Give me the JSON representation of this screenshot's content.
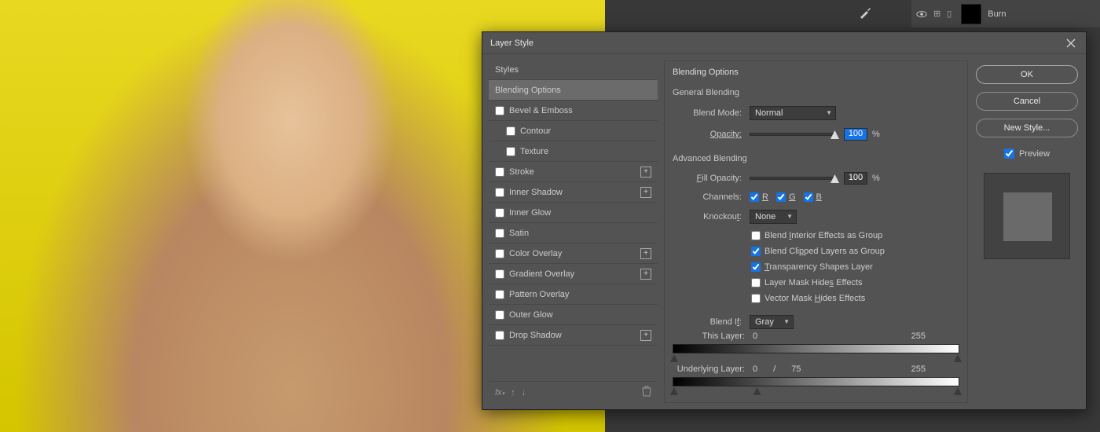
{
  "canvas": {},
  "layers_panel": {
    "rows": [
      {
        "label": "",
        "visible": true,
        "has_fx": true,
        "has_mask": true
      },
      {
        "label": "Burn",
        "visible": true,
        "has_fx": true,
        "has_mask": true
      }
    ]
  },
  "dialog": {
    "title": "Layer Style",
    "styles_header": "Styles",
    "effects": [
      {
        "label": "Blending Options",
        "selected": true,
        "checkbox": false,
        "plus": false
      },
      {
        "label": "Bevel & Emboss",
        "selected": false,
        "checkbox": true,
        "plus": false
      },
      {
        "label": "Contour",
        "selected": false,
        "checkbox": true,
        "plus": false,
        "indented": true
      },
      {
        "label": "Texture",
        "selected": false,
        "checkbox": true,
        "plus": false,
        "indented": true
      },
      {
        "label": "Stroke",
        "selected": false,
        "checkbox": true,
        "plus": true
      },
      {
        "label": "Inner Shadow",
        "selected": false,
        "checkbox": true,
        "plus": true
      },
      {
        "label": "Inner Glow",
        "selected": false,
        "checkbox": true,
        "plus": false
      },
      {
        "label": "Satin",
        "selected": false,
        "checkbox": true,
        "plus": false
      },
      {
        "label": "Color Overlay",
        "selected": false,
        "checkbox": true,
        "plus": true
      },
      {
        "label": "Gradient Overlay",
        "selected": false,
        "checkbox": true,
        "plus": true
      },
      {
        "label": "Pattern Overlay",
        "selected": false,
        "checkbox": true,
        "plus": false
      },
      {
        "label": "Outer Glow",
        "selected": false,
        "checkbox": true,
        "plus": false
      },
      {
        "label": "Drop Shadow",
        "selected": false,
        "checkbox": true,
        "plus": true
      }
    ],
    "options": {
      "section_title": "Blending Options",
      "general_title": "General Blending",
      "blend_mode_label": "Blend Mode:",
      "blend_mode_value": "Normal",
      "opacity_label": "Opacity:",
      "opacity_value": "100",
      "opacity_suffix": "%",
      "advanced_title": "Advanced Blending",
      "fill_opacity_label": "Fill Opacity:",
      "fill_opacity_value": "100",
      "fill_opacity_suffix": "%",
      "channels_label": "Channels:",
      "channel_r": "R",
      "channel_g": "G",
      "channel_b": "B",
      "knockout_label": "Knockout:",
      "knockout_value": "None",
      "cb_interior": "Blend Interior Effects as Group",
      "cb_clipped": "Blend Clipped Layers as Group",
      "cb_trans": "Transparency Shapes Layer",
      "cb_layer_mask": "Layer Mask Hides Effects",
      "cb_vector_mask": "Vector Mask Hides Effects",
      "blend_if_label": "Blend If:",
      "blend_if_value": "Gray",
      "this_layer_label": "This Layer:",
      "this_layer_low": "0",
      "this_layer_high": "255",
      "under_layer_label": "Underlying Layer:",
      "under_low": "0",
      "under_split": "/",
      "under_mid": "75",
      "under_high": "255"
    },
    "buttons": {
      "ok": "OK",
      "cancel": "Cancel",
      "new_style": "New Style...",
      "preview": "Preview"
    }
  }
}
